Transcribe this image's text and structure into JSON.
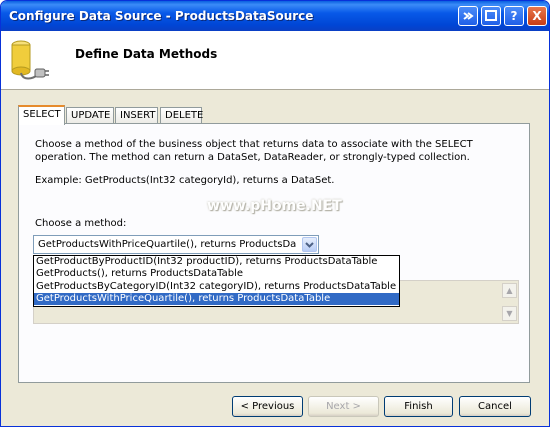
{
  "window": {
    "title": "Configure Data Source - ProductsDataSource",
    "buttons": {
      "help": "?",
      "close": "X"
    }
  },
  "header": {
    "title": "Define Data Methods"
  },
  "tabs": [
    {
      "label": "SELECT",
      "active": true
    },
    {
      "label": "UPDATE",
      "active": false
    },
    {
      "label": "INSERT",
      "active": false
    },
    {
      "label": "DELETE",
      "active": false
    }
  ],
  "select_panel": {
    "description": "Choose a method of the business object that returns data to associate with the SELECT operation. The method can return a DataSet, DataReader, or strongly-typed collection.",
    "example": "Example: GetProducts(Int32 categoryId), returns a DataSet.",
    "choose_label": "Choose a method:",
    "selected_method": "GetProductsWithPriceQuartile(), returns ProductsDataTable",
    "methods": [
      "GetProductByProductID(Int32 productID), returns ProductsDataTable",
      "GetProducts(), returns ProductsDataTable",
      "GetProductsByCategoryID(Int32 categoryID), returns ProductsDataTable",
      "GetProductsWithPriceQuartile(), returns ProductsDataTable"
    ],
    "highlighted_index": 3
  },
  "watermark": "www.pHome.NET",
  "footer": {
    "previous": "< Previous",
    "next": "Next >",
    "finish": "Finish",
    "cancel": "Cancel"
  }
}
